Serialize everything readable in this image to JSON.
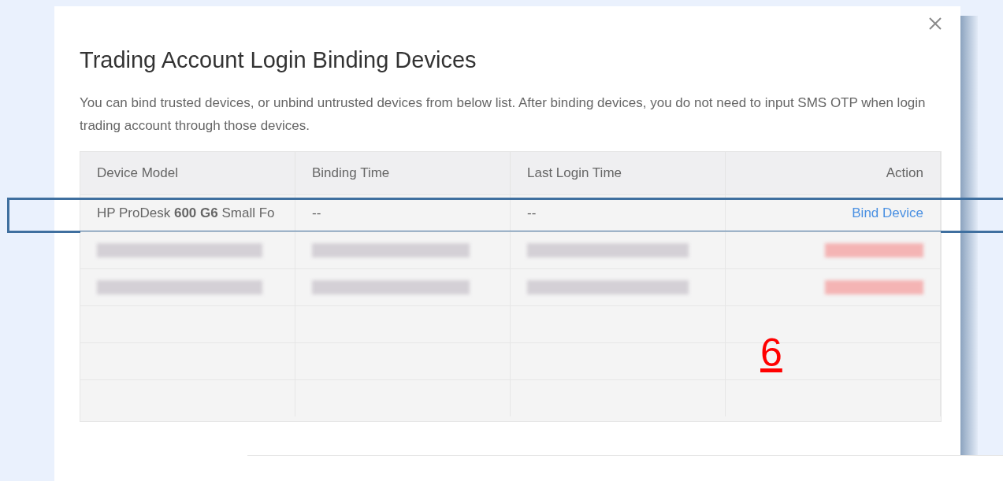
{
  "dialog": {
    "title": "Trading Account Login Binding Devices",
    "description": "You can bind trusted devices, or unbind untrusted devices from below list. After binding devices, you do not need to input SMS OTP when login trading account through those devices."
  },
  "table": {
    "columns": [
      "Device Model",
      "Binding Time",
      "Last Login Time",
      "Action"
    ],
    "rows": [
      {
        "kind": "device",
        "highlighted": true,
        "cells": [
          "HP ProDesk **600 G6** Small Fo",
          "--",
          "--"
        ],
        "action": "Bind Device"
      },
      {
        "kind": "redacted",
        "highlighted": false
      },
      {
        "kind": "redacted",
        "highlighted": false
      },
      {
        "kind": "empty",
        "highlighted": false
      },
      {
        "kind": "empty",
        "highlighted": false
      },
      {
        "kind": "empty",
        "highlighted": false
      }
    ]
  },
  "annotation": {
    "label": "6"
  }
}
